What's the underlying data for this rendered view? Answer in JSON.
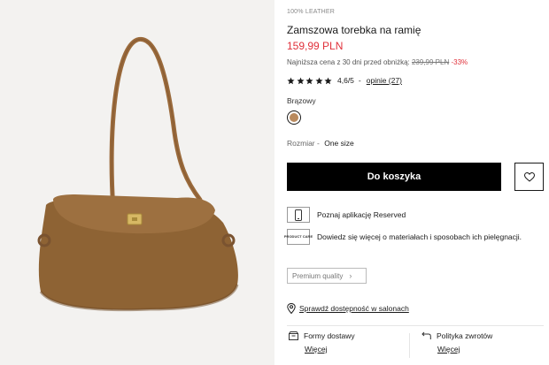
{
  "product": {
    "material": "100% LEATHER",
    "title": "Zamszowa torebka na ramię",
    "price": "159,99 PLN",
    "lowest_price_label": "Najniższa cena z 30 dni przed obniżką:",
    "old_price": "239,99 PLN",
    "discount": "-33%",
    "rating": {
      "stars": 5,
      "score": "4,6/5",
      "separator": "-",
      "reviews_label": "opinie (27)"
    },
    "color_name": "Brązowy",
    "swatch_color": "#b98a5e",
    "size_label": "Rozmiar -",
    "size_value": "One size",
    "image_icon": "suede-shoulder-bag"
  },
  "actions": {
    "add_to_cart": "Do koszyka",
    "wishlist_icon": "heart-icon"
  },
  "info": {
    "app_label": "Poznaj aplikację Reserved",
    "care_badge": "PRODUCT CARE",
    "care_label": "Dowiedz się więcej o materiałach i sposobach ich pielęgnacji.",
    "premium_label": "Premium quality",
    "store_label": "Sprawdź dostępność w salonach"
  },
  "footer": {
    "delivery_title": "Formy dostawy",
    "delivery_more": "Więcej",
    "returns_title": "Polityka zwrotów",
    "returns_more": "Więcej"
  },
  "colors": {
    "accent_red": "#e0303a",
    "button_black": "#000000"
  }
}
